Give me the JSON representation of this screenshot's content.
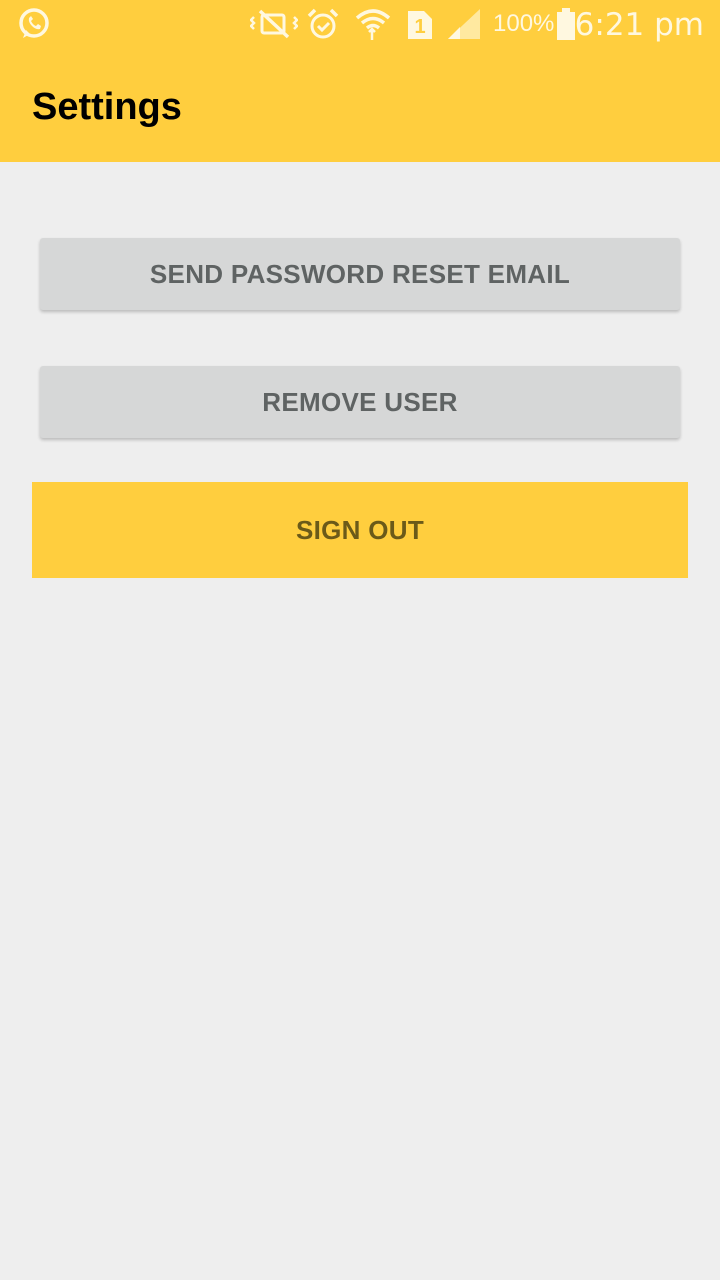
{
  "status_bar": {
    "icons": [
      "whatsapp-icon",
      "vibrate-mute-icon",
      "alarm-icon",
      "wifi-icon",
      "sim-1-icon",
      "signal-icon",
      "battery-icon"
    ],
    "battery_percent": "100%",
    "time": "6:21 pm"
  },
  "app_bar": {
    "title": "Settings"
  },
  "actions": {
    "send_reset_label": "SEND PASSWORD RESET EMAIL",
    "remove_user_label": "REMOVE USER",
    "sign_out_label": "SIGN OUT"
  },
  "colors": {
    "accent": "#ffce3e",
    "background": "#eeeeee",
    "button_gray": "#d6d7d7",
    "button_text_gray": "#5f6363",
    "sign_out_text": "#6b5a19"
  }
}
